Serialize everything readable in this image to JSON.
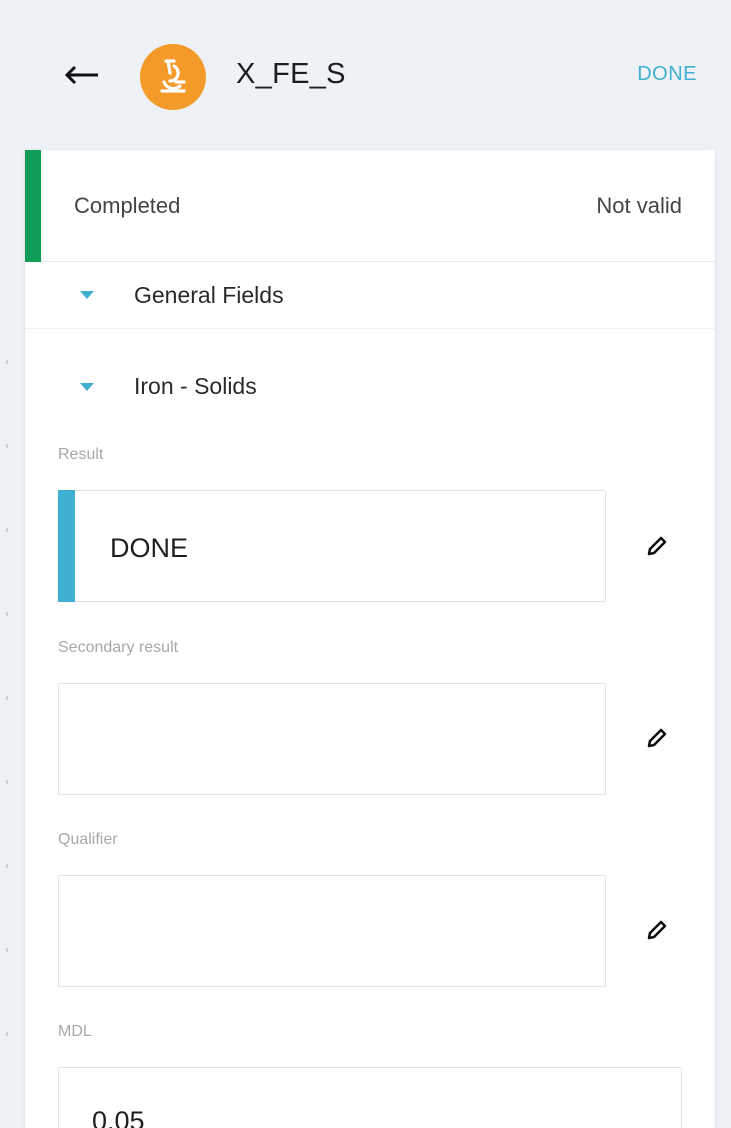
{
  "header": {
    "title": "X_FE_S",
    "done_label": "DONE",
    "back_icon": "arrow-left-icon",
    "avatar_icon": "microscope-icon"
  },
  "status": {
    "state": "Completed",
    "validity": "Not valid"
  },
  "sections": [
    {
      "label": "General Fields",
      "icon": "caret-down-icon"
    },
    {
      "label": "Iron - Solids",
      "icon": "caret-down-icon"
    }
  ],
  "fields": {
    "result": {
      "label": "Result",
      "value": "DONE"
    },
    "secondary_result": {
      "label": "Secondary result",
      "value": ""
    },
    "qualifier": {
      "label": "Qualifier",
      "value": ""
    },
    "mdl": {
      "label": "MDL",
      "value": "0.05"
    }
  },
  "colors": {
    "background": "#eef1f5",
    "accent_blue": "#3fb0cf",
    "avatar_orange": "#f39a2b",
    "status_green": "#0f9d58"
  }
}
